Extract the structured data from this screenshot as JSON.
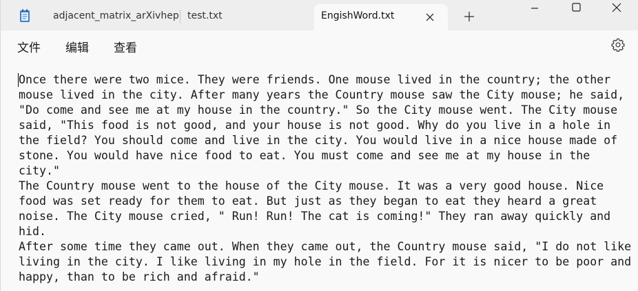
{
  "tabs": [
    {
      "label": "adjacent_matrix_arXivhep-"
    },
    {
      "label": "test.txt"
    },
    {
      "label": "EngishWord.txt"
    }
  ],
  "menu": {
    "file": "文件",
    "edit": "编辑",
    "view": "查看"
  },
  "icons": {
    "app": "notepad-icon",
    "tab_close": "close-icon",
    "new_tab": "plus-icon",
    "minimize": "minimize-icon",
    "maximize": "maximize-icon",
    "window_close": "close-icon",
    "settings": "gear-icon"
  },
  "editor": {
    "lines": [
      "Once there were two mice. They were friends. One mouse lived in the country; the other",
      "mouse lived in the city. After many years the Country mouse saw the City mouse; he said,",
      "\"Do come and see me at my house in the country.\" So the City mouse went. The City mouse",
      "said, \"This food is not good, and your house is not good. Why do you live in a hole in",
      "the field? You should come and live in the city. You would live in a nice house made of",
      "stone. You would have nice food to eat. You must come and see me at my house in the",
      "city.\"",
      "The Country mouse went to the house of the City mouse. It was a very good house. Nice",
      "food was set ready for them to eat. But just as they began to eat they heard a great",
      "noise. The City mouse cried, \" Run! Run! The cat is coming!\" They ran away quickly and",
      "hid.",
      "After some time they came out. When they came out, the Country mouse said, \"I do not like",
      "living in the city. I like living in my hole in the field. For it is nicer to be poor and",
      "happy, than to be rich and afraid.\""
    ]
  }
}
